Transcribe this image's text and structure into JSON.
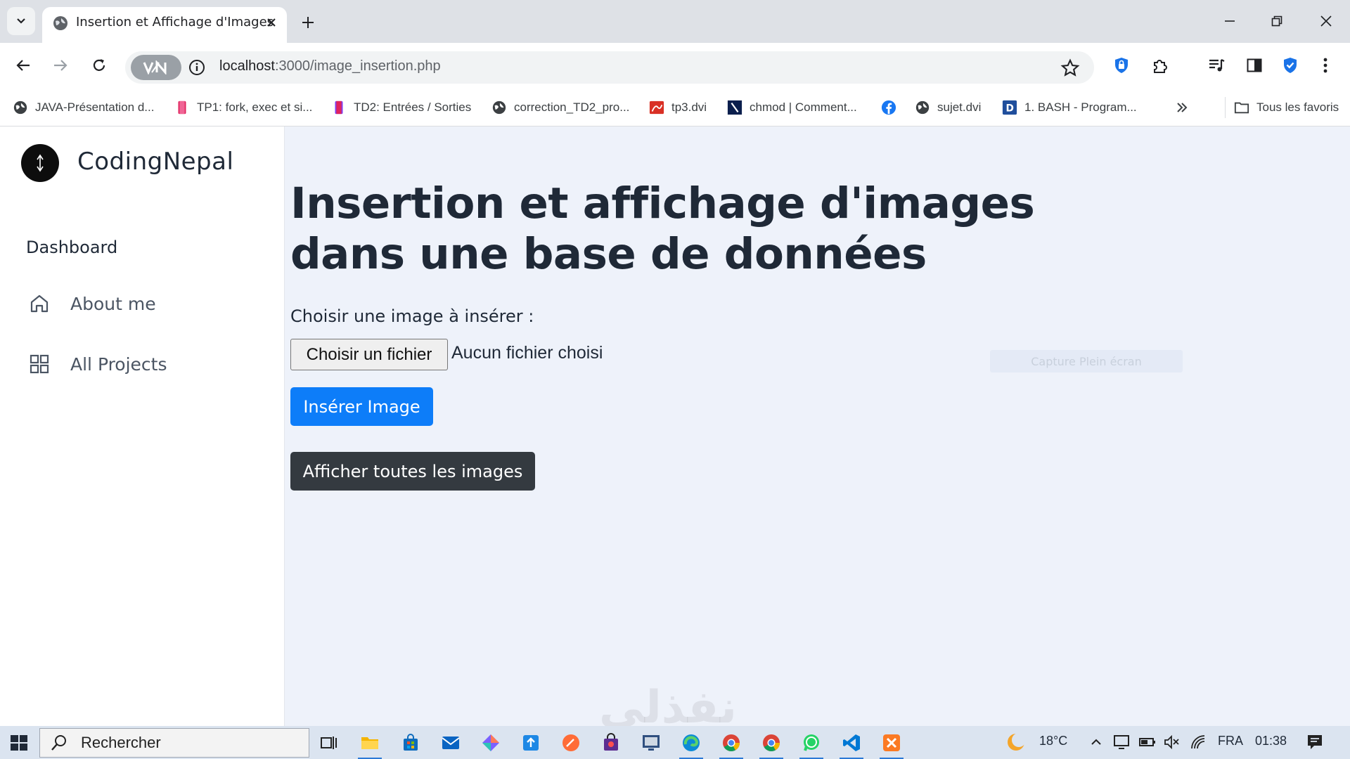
{
  "browser": {
    "tab_title": "Insertion et Affichage d'Images",
    "url_host": "localhost",
    "url_path": ":3000/image_insertion.php",
    "bookmarks": [
      {
        "label": "JAVA-Présentation d...",
        "icon": "globe-icon"
      },
      {
        "label": "TP1: fork, exec et si...",
        "icon": "bookmark-icon"
      },
      {
        "label": "TD2: Entrées / Sorties",
        "icon": "bookmark-icon"
      },
      {
        "label": "correction_TD2_pro...",
        "icon": "globe-icon"
      },
      {
        "label": "tp3.dvi",
        "icon": "pdf-icon"
      },
      {
        "label": "chmod | Comment...",
        "icon": "site-icon"
      },
      {
        "label": "",
        "icon": "facebook-icon"
      },
      {
        "label": "sujet.dvi",
        "icon": "globe-icon"
      },
      {
        "label": "1. BASH - Program...",
        "icon": "doc-icon"
      }
    ],
    "all_bookmarks_label": "Tous les favoris"
  },
  "sidebar": {
    "brand": "CodingNepal",
    "section": "Dashboard",
    "items": [
      {
        "label": "About me",
        "icon": "home-icon"
      },
      {
        "label": "All Projects",
        "icon": "grid-icon"
      }
    ]
  },
  "main": {
    "heading_line1": "Insertion et affichage d'images",
    "heading_line2": "dans une base de données",
    "file_label": "Choisir une image à insérer :",
    "file_button": "Choisir un fichier",
    "file_status": "Aucun fichier choisi",
    "insert_button": "Insérer Image",
    "show_button": "Afficher toutes les images",
    "overlay_hint": "Capture Plein écran",
    "watermark": "نفذلي"
  },
  "taskbar": {
    "search_placeholder": "Rechercher",
    "temperature": "18°C",
    "language": "FRA",
    "time": "01:38"
  },
  "colors": {
    "primary": "#0d7df9",
    "dark": "#343a40",
    "page_bg": "#eef2fa"
  }
}
